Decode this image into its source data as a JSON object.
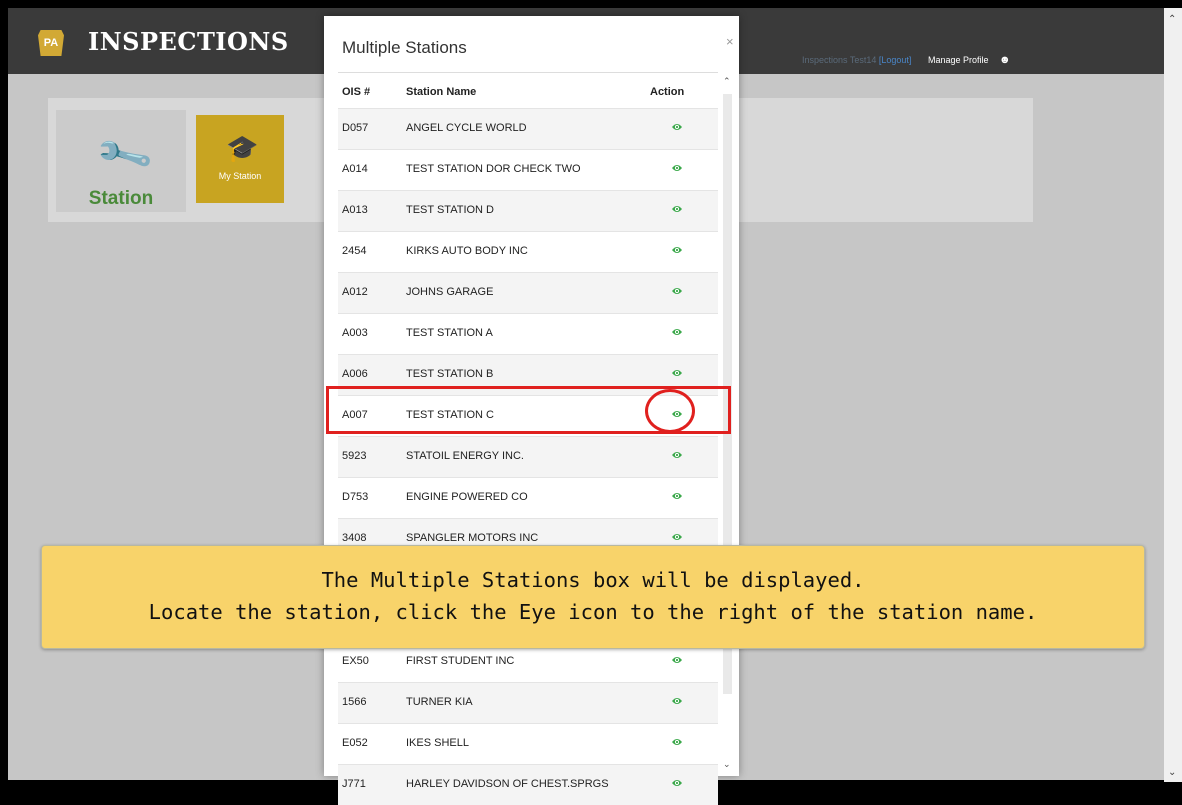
{
  "header": {
    "logo_text": "PA",
    "app_title": "INSPECTIONS",
    "user": "Inspections Test14",
    "logout": "[Logout]",
    "manage_profile": "Manage Profile"
  },
  "dashboard": {
    "station_label": "Station",
    "my_station_label": "My Station"
  },
  "modal": {
    "title": "Multiple Stations",
    "close": "×",
    "columns": {
      "ois": "OIS #",
      "name": "Station Name",
      "action": "Action"
    },
    "rows": [
      {
        "ois": "D057",
        "name": "ANGEL CYCLE WORLD"
      },
      {
        "ois": "A014",
        "name": "TEST STATION DOR CHECK TWO"
      },
      {
        "ois": "A013",
        "name": "TEST STATION D"
      },
      {
        "ois": "2454",
        "name": "KIRKS AUTO BODY INC"
      },
      {
        "ois": "A012",
        "name": "JOHNS GARAGE"
      },
      {
        "ois": "A003",
        "name": "TEST STATION A"
      },
      {
        "ois": "A006",
        "name": "TEST STATION B"
      },
      {
        "ois": "A007",
        "name": "TEST STATION C"
      },
      {
        "ois": "5923",
        "name": "STATOIL ENERGY INC."
      },
      {
        "ois": "D753",
        "name": "ENGINE POWERED CO"
      },
      {
        "ois": "3408",
        "name": "SPANGLER MOTORS INC"
      },
      {
        "ois": "",
        "name": ""
      },
      {
        "ois": "",
        "name": ""
      },
      {
        "ois": "EX50",
        "name": "FIRST STUDENT INC"
      },
      {
        "ois": "1566",
        "name": "TURNER KIA"
      },
      {
        "ois": "E052",
        "name": "IKES SHELL"
      },
      {
        "ois": "J771",
        "name": "HARLEY DAVIDSON OF CHEST.SPRGS"
      }
    ],
    "eye_icon_color": "#3aa84a"
  },
  "callout": {
    "line1": "The Multiple Stations box will be displayed.",
    "line2": "Locate the station, click the Eye icon to the right of the station name."
  },
  "colors": {
    "topbar": "#3a3a3a",
    "highlight": "#e0201e",
    "callout_bg": "#f8d36a",
    "tile_gold": "#c8a421",
    "station_green": "#4a8a3a"
  }
}
